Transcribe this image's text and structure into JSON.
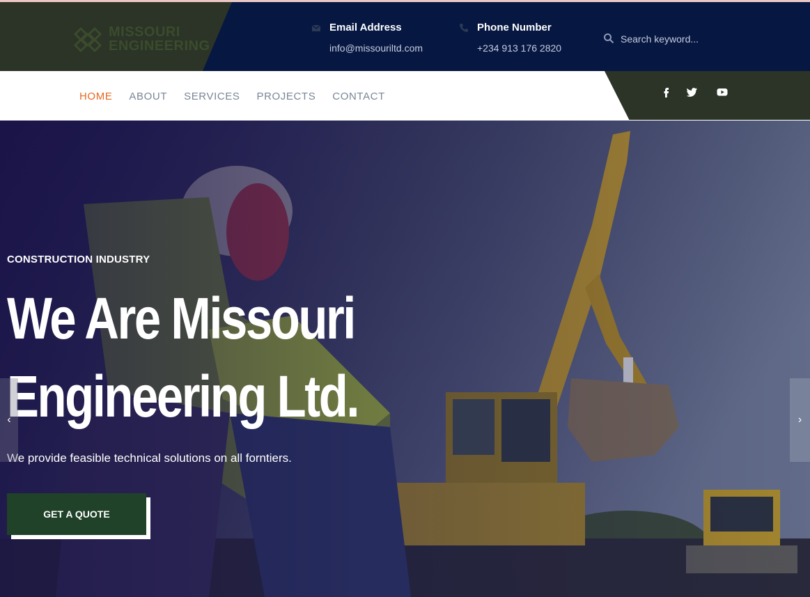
{
  "brand": {
    "logo_line1": "MISSOURI",
    "logo_line2": "ENGINEERING",
    "logo_color": "#3b4b2c"
  },
  "contact": {
    "email_label": "Email Address",
    "email_value": "info@missouriltd.com",
    "phone_label": "Phone Number",
    "phone_value": "+234 913 176 2820"
  },
  "search": {
    "placeholder": "Search keyword..."
  },
  "nav": {
    "items": [
      "HOME",
      "ABOUT",
      "SERVICES",
      "PROJECTS",
      "CONTACT"
    ],
    "active": "HOME",
    "active_color": "#e8681f"
  },
  "social": {
    "icons": [
      "facebook-icon",
      "twitter-icon",
      "youtube-icon"
    ]
  },
  "hero": {
    "kicker": "CONSTRUCTION INDUSTRY",
    "headline_line1": "We Are Missouri",
    "headline_line2": "Engineering Ltd.",
    "subtitle": "We provide feasible technical solutions on all forntiers.",
    "cta_label": "GET A QUOTE",
    "arrow_prev": "‹",
    "arrow_next": "›"
  },
  "colors": {
    "topbar_bg": "#061742",
    "brand_green": "#2b3427",
    "cta_green": "#1f4229"
  }
}
